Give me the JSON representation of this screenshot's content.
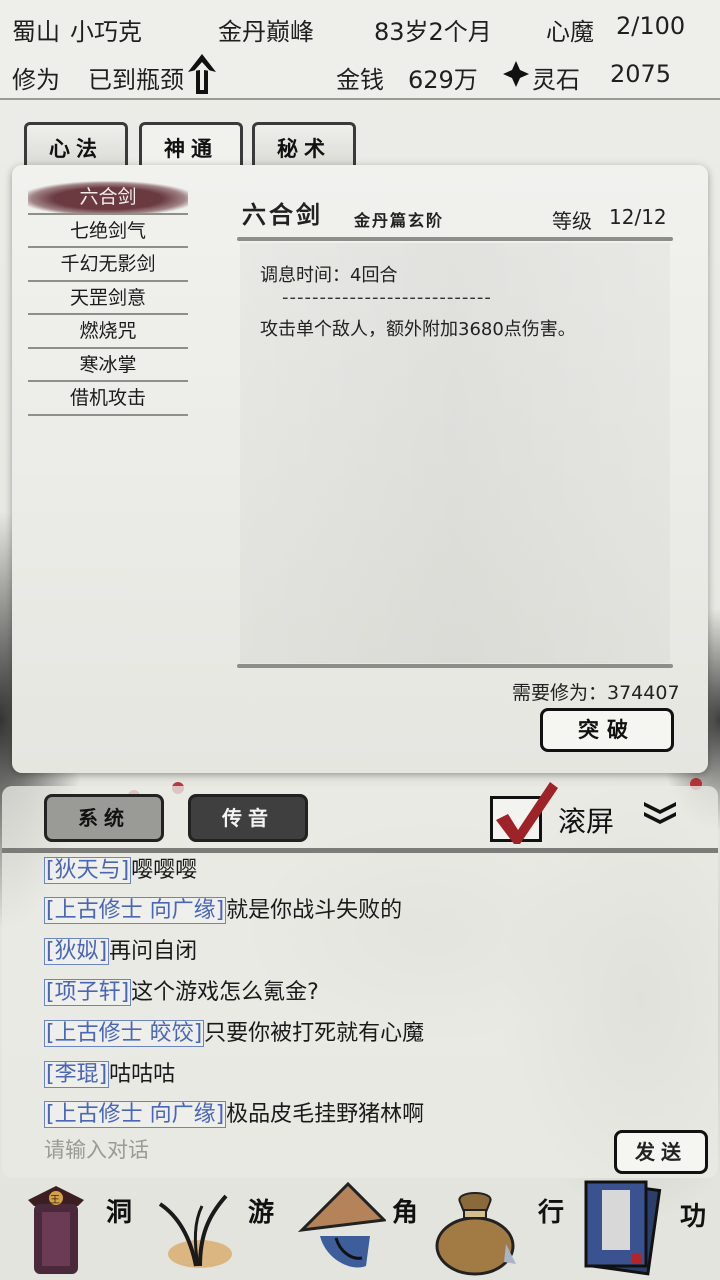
{
  "header": {
    "location": "蜀山",
    "name": "小巧克",
    "realm": "金丹巅峰",
    "age": "83岁2个月",
    "demon_label": "心魔",
    "demon_value": "2/100",
    "cultivation_label": "修为",
    "cultivation_status": "已到瓶颈",
    "money_label": "金钱",
    "money_value": "629万",
    "spirit_stone_label": "灵石",
    "spirit_stone_value": "2075"
  },
  "tabs": [
    {
      "label": "心法"
    },
    {
      "label": "神通"
    },
    {
      "label": "秘术"
    }
  ],
  "skills": {
    "items": [
      "六合剑",
      "七绝剑气",
      "千幻无影剑",
      "天罡剑意",
      "燃烧咒",
      "寒冰掌",
      "借机攻击"
    ],
    "selected_index": 0
  },
  "detail": {
    "title": "六合剑",
    "tier": "金丹篇玄阶",
    "level_label": "等级",
    "level_value": "12/12",
    "cooldown": "调息时间：4回合",
    "separator": "----------------------------",
    "description": "攻击单个敌人，额外附加3680点伤害。",
    "required": "需要修为：374407",
    "break_label": "突破"
  },
  "chat": {
    "tab_system": "系统",
    "tab_voice": "传音",
    "scroll_label": "滚屏",
    "scroll_checked": true,
    "messages": [
      {
        "name": "[狄天与]",
        "text": "嘤嘤嘤"
      },
      {
        "name": "[上古修士 向广缘]",
        "text": "就是你战斗失败的"
      },
      {
        "name": "[狄姒]",
        "text": "再问自闭"
      },
      {
        "name": "[项子轩]",
        "text": "这个游戏怎么氪金?"
      },
      {
        "name": "[上古修士 皎饺]",
        "text": "只要你被打死就有心魔"
      },
      {
        "name": "[李琨]",
        "text": "咕咕咕"
      },
      {
        "name": "[上古修士 向广缘]",
        "text": "极品皮毛挂野猪林啊"
      }
    ],
    "input_placeholder": "请输入对话",
    "send_label": "发送"
  },
  "nav": {
    "items": [
      {
        "label": "洞",
        "icon": "cave-lantern-icon"
      },
      {
        "label": "游",
        "icon": "grass-icon"
      },
      {
        "label": "角",
        "icon": "straw-hat-icon"
      },
      {
        "label": "行",
        "icon": "bag-icon"
      },
      {
        "label": "功",
        "icon": "book-icon"
      }
    ]
  },
  "colors": {
    "accent_red": "#b2262b",
    "name_blue": "#4a66b8",
    "selected_skill_bg": "#6a3a40"
  }
}
